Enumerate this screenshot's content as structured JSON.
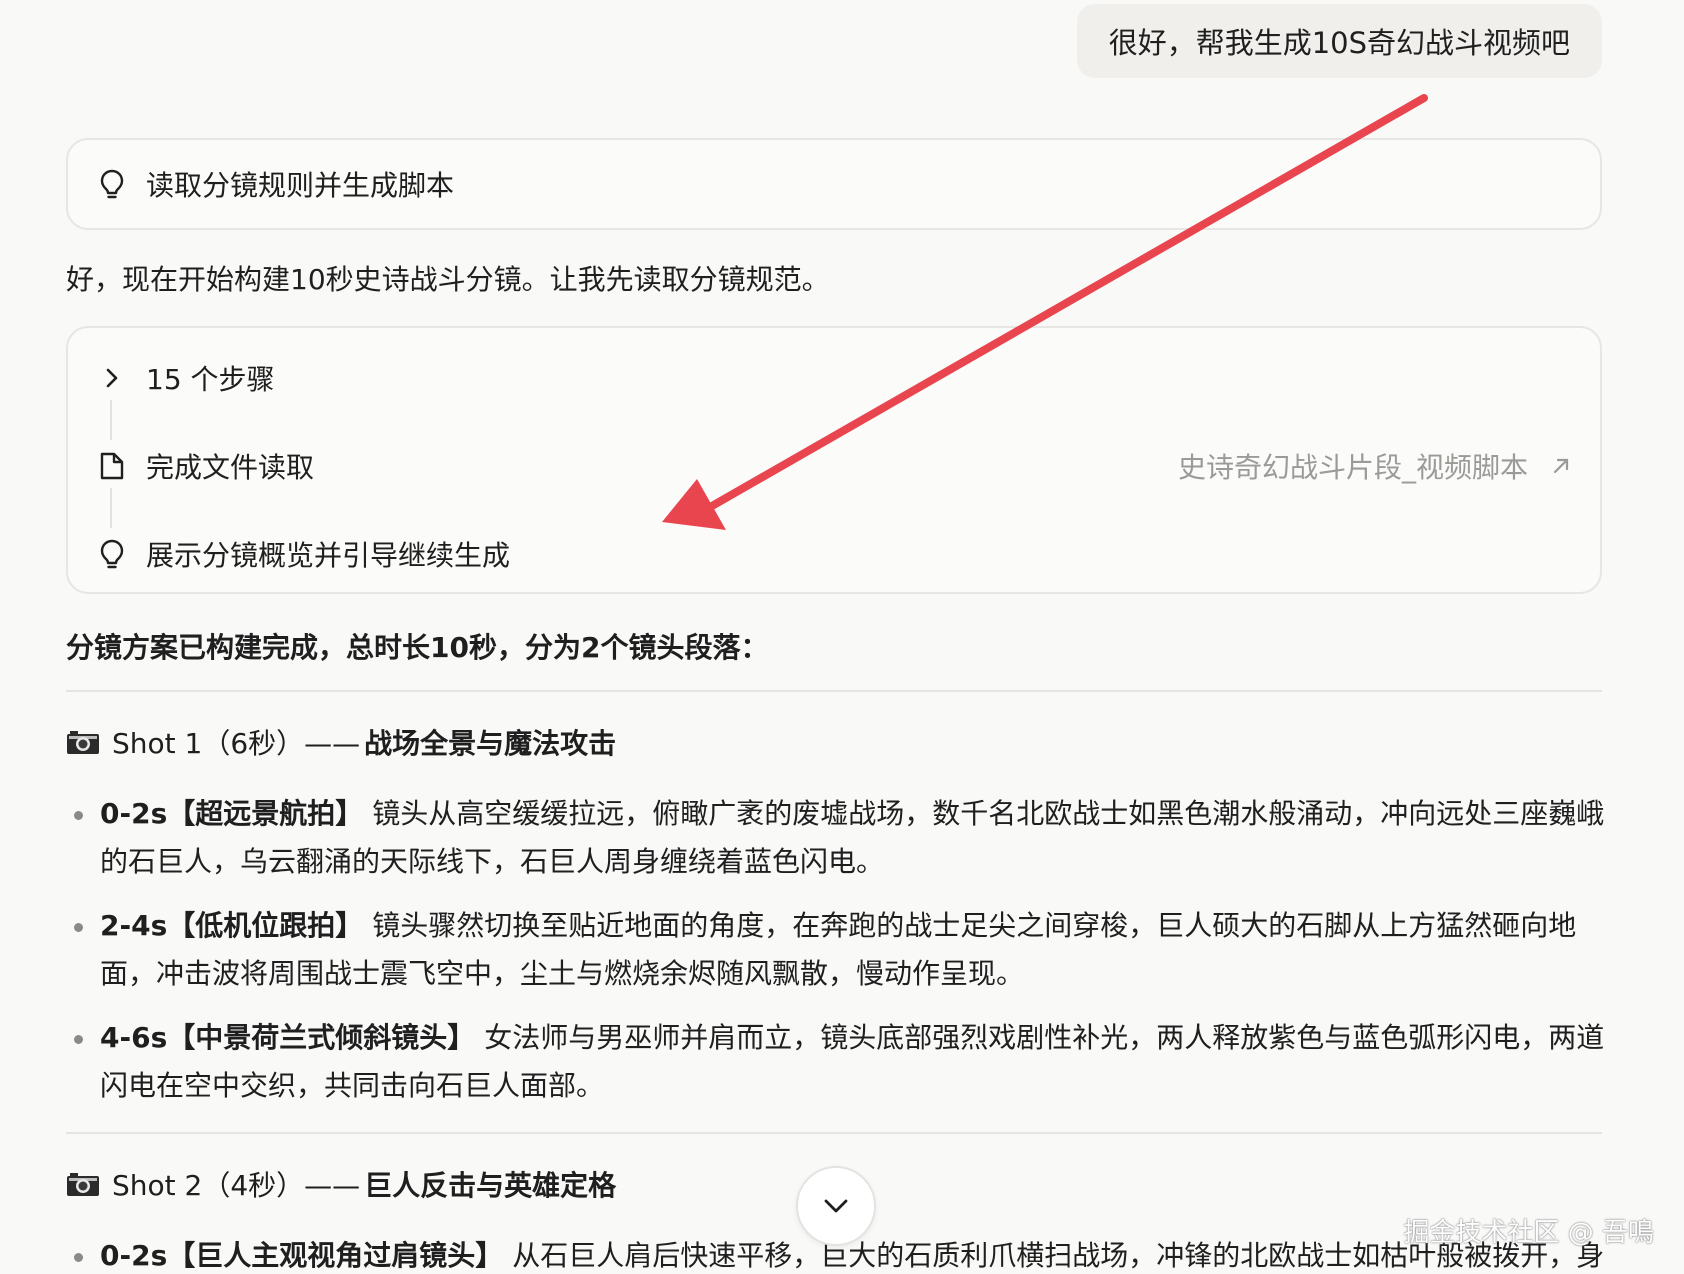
{
  "user_message": "很好，帮我生成10S奇幻战斗视频吧",
  "task": {
    "label": "读取分镜规则并生成脚本",
    "icon": "lightbulb-icon"
  },
  "intro": "好，现在开始构建10秒史诗战斗分镜。让我先读取分镜规范。",
  "steps": {
    "toggle_label": "15 个步骤",
    "items": [
      {
        "label": "完成文件读取",
        "icon": "file-icon"
      },
      {
        "label": "展示分镜概览并引导继续生成",
        "icon": "lightbulb-icon"
      }
    ],
    "file_link": {
      "label": "史诗奇幻战斗片段_视频脚本",
      "icon": "external-link-icon"
    }
  },
  "summary": "分镜方案已构建完成，总时长10秒，分为2个镜头段落：",
  "shots": [
    {
      "icon": "camera-icon",
      "prefix": "Shot 1（6秒）——",
      "name": "战场全景与魔法攻击",
      "beats": [
        {
          "time": "0-2s",
          "tag": "【超远景航拍】",
          "text": "镜头从高空缓缓拉远，俯瞰广袤的废墟战场，数千名北欧战士如黑色潮水般涌动，冲向远处三座巍峨的石巨人，乌云翻涌的天际线下，石巨人周身缠绕着蓝色闪电。"
        },
        {
          "time": "2-4s",
          "tag": "【低机位跟拍】",
          "text": "镜头骤然切换至贴近地面的角度，在奔跑的战士足尖之间穿梭，巨人硕大的石脚从上方猛然砸向地面，冲击波将周围战士震飞空中，尘土与燃烧余烬随风飘散，慢动作呈现。"
        },
        {
          "time": "4-6s",
          "tag": "【中景荷兰式倾斜镜头】",
          "text": "女法师与男巫师并肩而立，镜头底部强烈戏剧性补光，两人释放紫色与蓝色弧形闪电，两道闪电在空中交织，共同击向石巨人面部。"
        }
      ]
    },
    {
      "icon": "camera-icon",
      "prefix": "Shot 2（4秒）——",
      "name": "巨人反击与英雄定格",
      "beats": [
        {
          "time": "0-2s",
          "tag": "【巨人主观视角过肩镜头】",
          "text": "从石巨人肩后快速平移，巨大的石质利爪横扫战场，冲锋的北欧战士如枯叶般被拨开，身"
        }
      ]
    }
  ],
  "scroll_icon": "chevron-down-icon",
  "watermark": "掘金技术社区 @ 吾鳴",
  "colors": {
    "annotation_arrow": "#e8454e",
    "muted_text": "#9a9a97"
  }
}
